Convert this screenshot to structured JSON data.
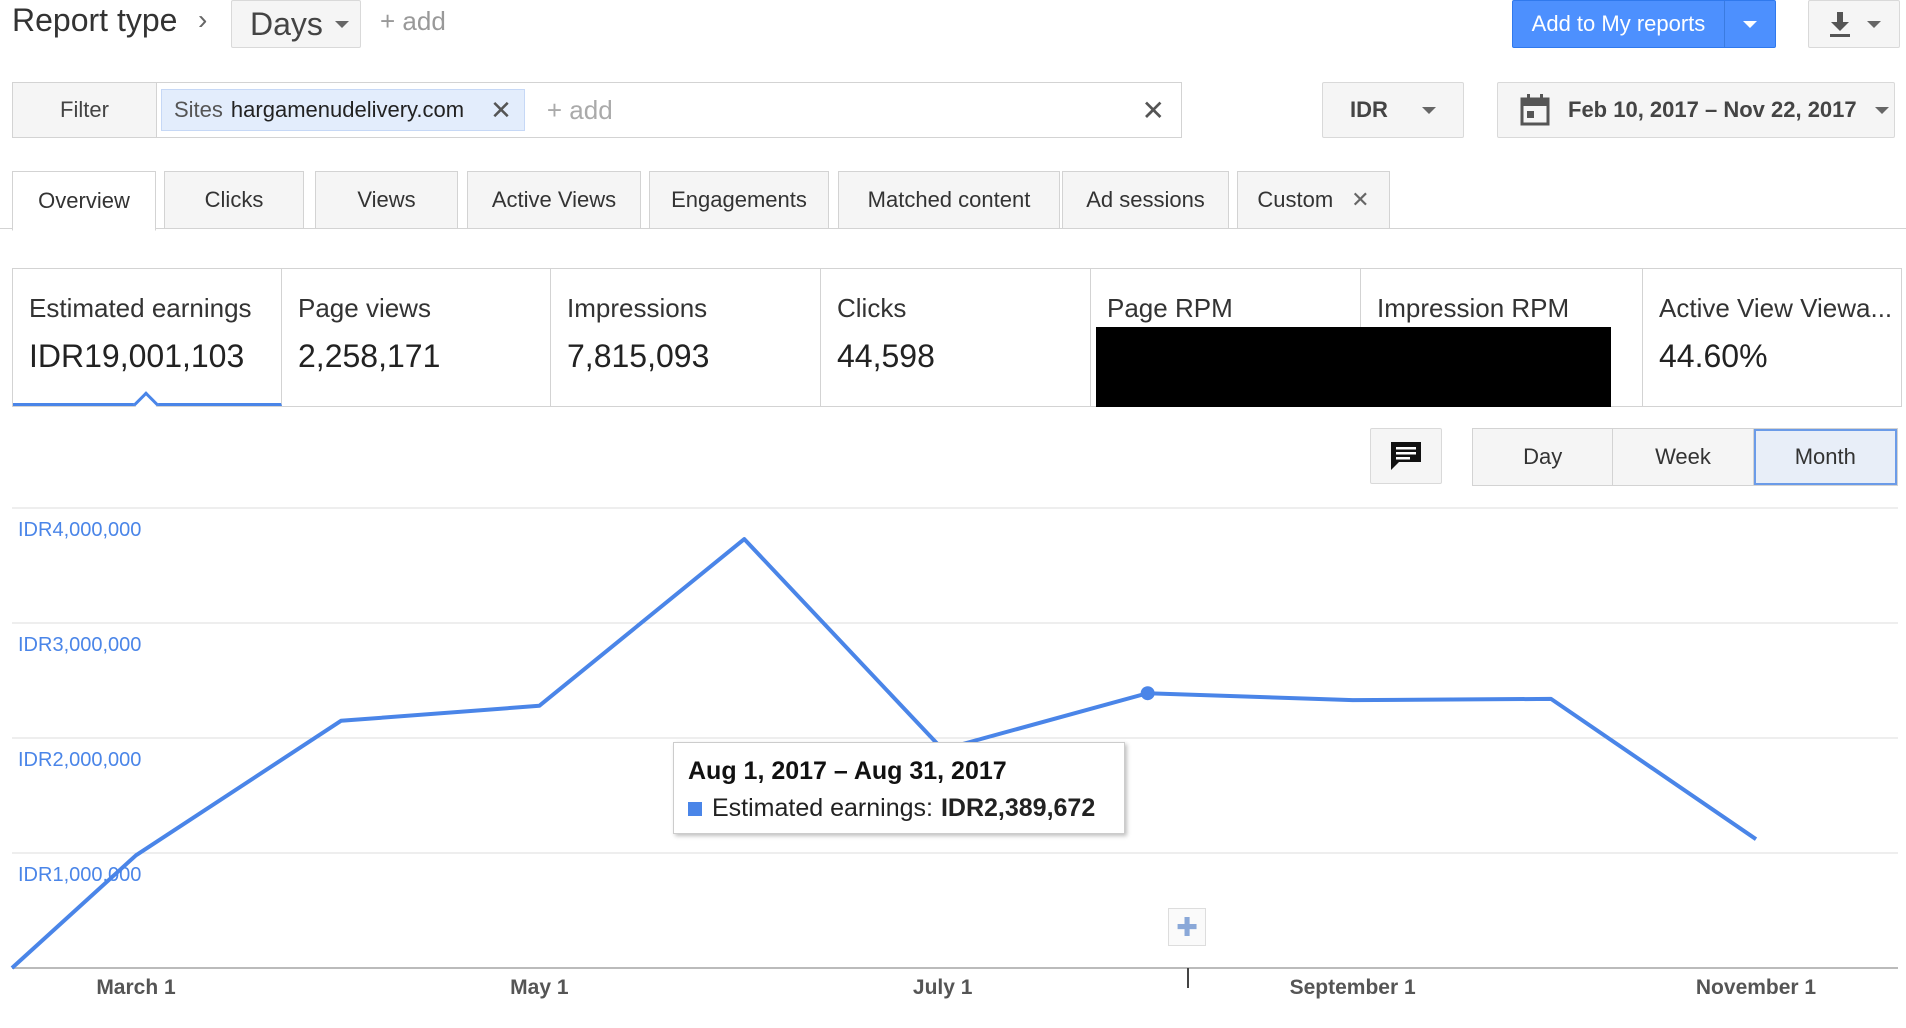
{
  "header": {
    "report_type_label": "Report type",
    "breadcrumb_separator": "›",
    "granularity_select": "Days",
    "add_label": "+ add",
    "add_to_reports_label": "Add to My reports",
    "download_icon": "download-icon"
  },
  "filter": {
    "label": "Filter",
    "chip_key": "Sites",
    "chip_value": "hargamenudelivery.com",
    "chip_close": "✕",
    "add_placeholder": "+ add",
    "clear": "✕"
  },
  "currency": "IDR",
  "date_range": "Feb 10, 2017 – Nov 22, 2017",
  "tabs": [
    {
      "label": "Overview",
      "active": true
    },
    {
      "label": "Clicks"
    },
    {
      "label": "Views"
    },
    {
      "label": "Active Views"
    },
    {
      "label": "Engagements"
    },
    {
      "label": "Matched content"
    },
    {
      "label": "Ad sessions"
    },
    {
      "label": "Custom",
      "closable": true,
      "close": "✕"
    }
  ],
  "metrics": [
    {
      "label": "Estimated earnings",
      "value": "IDR19,001,103",
      "selected": true
    },
    {
      "label": "Page views",
      "value": "2,258,171"
    },
    {
      "label": "Impressions",
      "value": "7,815,093"
    },
    {
      "label": "Clicks",
      "value": "44,598"
    },
    {
      "label": "Page RPM",
      "value": ""
    },
    {
      "label": "Impression RPM",
      "value": ""
    },
    {
      "label": "Active View Viewa...",
      "value": "44.60%"
    }
  ],
  "granularity": {
    "options": [
      "Day",
      "Week",
      "Month"
    ],
    "selected": "Month"
  },
  "colors": {
    "accent": "#4a85e8",
    "button_blue": "#4d90fe"
  },
  "chart_data": {
    "type": "line",
    "x_labels": [
      "March 1",
      "May 1",
      "July 1",
      "September 1",
      "November 1"
    ],
    "y_ticks": [
      "IDR1,000,000",
      "IDR2,000,000",
      "IDR3,000,000",
      "IDR4,000,000"
    ],
    "ylim": [
      0,
      4000000
    ],
    "grid": true,
    "series": [
      {
        "name": "Estimated earnings",
        "points": [
          {
            "x": "2017-02-10",
            "y": 0
          },
          {
            "x": "2017-03-01",
            "y": 980000
          },
          {
            "x": "2017-04-01",
            "y": 2150000
          },
          {
            "x": "2017-05-01",
            "y": 2280000
          },
          {
            "x": "2017-06-01",
            "y": 3730000
          },
          {
            "x": "2017-07-01",
            "y": 1900000
          },
          {
            "x": "2017-08-01",
            "y": 2389672
          },
          {
            "x": "2017-09-01",
            "y": 2330000
          },
          {
            "x": "2017-10-01",
            "y": 2340000
          },
          {
            "x": "2017-11-01",
            "y": 1120000
          }
        ]
      }
    ],
    "highlighted_index": 6,
    "tooltip": {
      "title": "Aug 1, 2017 – Aug 31, 2017",
      "series_label": "Estimated earnings:",
      "value": "IDR2,389,672"
    },
    "annotation_marker": "✚"
  }
}
